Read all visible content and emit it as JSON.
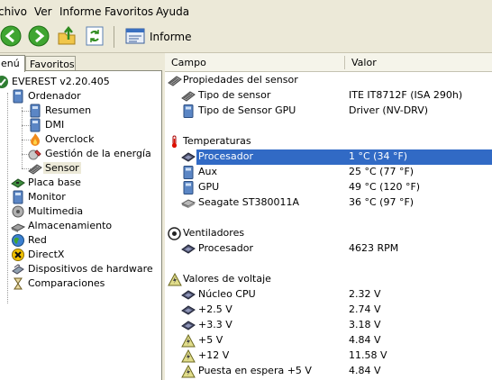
{
  "menu": [
    "chivo",
    "Ver",
    "Informe",
    "Favoritos",
    "Ayuda"
  ],
  "toolbar": {
    "report_label": "Informe"
  },
  "left": {
    "tabs": [
      "enú",
      "Favoritos"
    ],
    "tree": [
      {
        "label": "EVEREST v2.20.405",
        "icon": "everest-icon"
      },
      {
        "label": "Ordenador",
        "icon": "computer-icon"
      },
      {
        "label": "Resumen",
        "icon": "computer-icon"
      },
      {
        "label": "DMI",
        "icon": "computer-icon"
      },
      {
        "label": "Overclock",
        "icon": "flame-icon"
      },
      {
        "label": "Gestión de la energía",
        "icon": "power-icon"
      },
      {
        "label": "Sensor",
        "icon": "sensor-icon",
        "selected": true
      },
      {
        "label": "Placa base",
        "icon": "motherboard-icon"
      },
      {
        "label": "Monitor",
        "icon": "monitor-icon"
      },
      {
        "label": "Multimedia",
        "icon": "multimedia-icon"
      },
      {
        "label": "Almacenamiento",
        "icon": "storage-icon"
      },
      {
        "label": "Red",
        "icon": "network-icon"
      },
      {
        "label": "DirectX",
        "icon": "directx-icon"
      },
      {
        "label": "Dispositivos de hardware",
        "icon": "devices-icon"
      },
      {
        "label": "Comparaciones",
        "icon": "benchmark-icon"
      }
    ]
  },
  "grid": {
    "columns": [
      "Campo",
      "Valor"
    ],
    "rows": [
      {
        "kind": "group",
        "label": "Propiedades del sensor",
        "value": "",
        "icon": "sensor-icon"
      },
      {
        "kind": "item",
        "label": "Tipo de sensor",
        "value": "ITE IT8712F  (ISA 290h)",
        "icon": "sensor-icon"
      },
      {
        "kind": "item",
        "label": "Tipo de Sensor GPU",
        "value": "Driver  (NV-DRV)",
        "icon": "computer-icon"
      },
      {
        "kind": "blank"
      },
      {
        "kind": "group",
        "label": "Temperaturas",
        "value": "",
        "icon": "thermometer-icon"
      },
      {
        "kind": "item",
        "label": "Procesador",
        "value": "1 °C  (34 °F)",
        "icon": "cpu-icon",
        "selected": true
      },
      {
        "kind": "item",
        "label": "Aux",
        "value": "25 °C  (77 °F)",
        "icon": "computer-icon"
      },
      {
        "kind": "item",
        "label": "GPU",
        "value": "49 °C  (120 °F)",
        "icon": "computer-icon"
      },
      {
        "kind": "item",
        "label": "Seagate ST380011A",
        "value": "36 °C  (97 °F)",
        "icon": "disk-icon"
      },
      {
        "kind": "blank"
      },
      {
        "kind": "group",
        "label": "Ventiladores",
        "value": "",
        "icon": "fan-icon"
      },
      {
        "kind": "item",
        "label": "Procesador",
        "value": "4623 RPM",
        "icon": "cpu-icon"
      },
      {
        "kind": "blank"
      },
      {
        "kind": "group",
        "label": "Valores de voltaje",
        "value": "",
        "icon": "voltage-icon"
      },
      {
        "kind": "item",
        "label": "Núcleo CPU",
        "value": "2.32 V",
        "icon": "cpu-icon"
      },
      {
        "kind": "item",
        "label": "+2.5 V",
        "value": "2.74 V",
        "icon": "cpu-icon"
      },
      {
        "kind": "item",
        "label": "+3.3 V",
        "value": "3.18 V",
        "icon": "cpu-icon"
      },
      {
        "kind": "item",
        "label": "+5 V",
        "value": "4.84 V",
        "icon": "voltage-icon"
      },
      {
        "kind": "item",
        "label": "+12 V",
        "value": "11.58 V",
        "icon": "voltage-icon"
      },
      {
        "kind": "item",
        "label": "Puesta en espera +5 V",
        "value": "4.84 V",
        "icon": "voltage-icon"
      }
    ]
  },
  "colors": {
    "selection": "#316ac5",
    "chrome": "#ece9d8"
  }
}
